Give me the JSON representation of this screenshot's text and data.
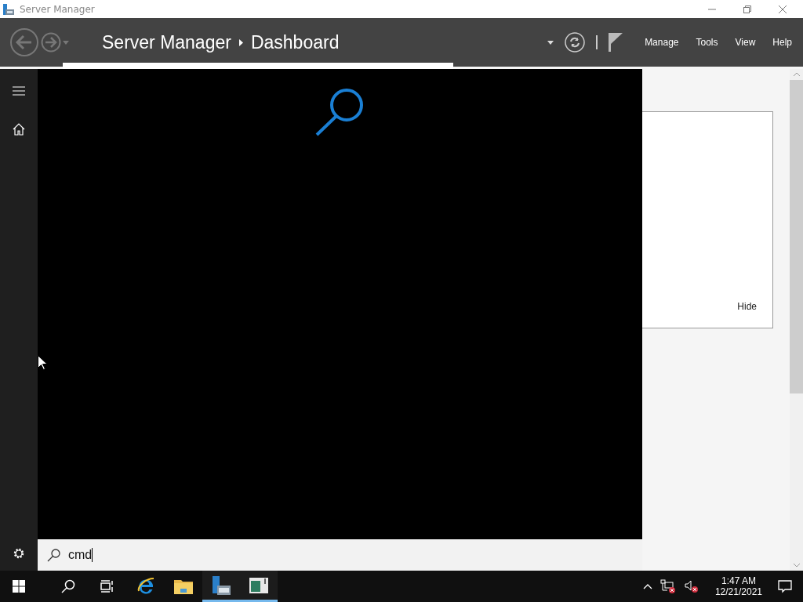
{
  "window": {
    "title": "Server Manager"
  },
  "header": {
    "breadcrumb": [
      {
        "label": "Server Manager"
      },
      {
        "label": "Dashboard"
      }
    ],
    "menu": [
      {
        "label": "Manage"
      },
      {
        "label": "Tools"
      },
      {
        "label": "View"
      },
      {
        "label": "Help"
      }
    ]
  },
  "panel": {
    "hide_link": "Hide"
  },
  "start_search": {
    "value": "cmd"
  },
  "taskbar": {
    "apps": [
      {
        "kind": "browser",
        "running": false
      },
      {
        "kind": "folder",
        "running": false
      },
      {
        "kind": "server",
        "running": true
      },
      {
        "kind": "console",
        "running": true
      }
    ],
    "time": "1:47 AM",
    "date": "12/21/2021"
  }
}
